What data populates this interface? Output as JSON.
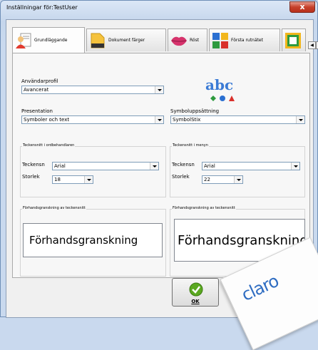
{
  "window": {
    "title": "Inställningar för:TestUser",
    "close_label": "x"
  },
  "tabs": [
    {
      "label": "Grundläggande",
      "icon": "person-icon",
      "active": true
    },
    {
      "label": "Dokument färger",
      "icon": "document-icon",
      "active": false
    },
    {
      "label": "Röst",
      "icon": "lips-icon",
      "active": false
    },
    {
      "label": "Första rutnätet",
      "icon": "grid-icon",
      "active": false
    },
    {
      "label": "",
      "icon": "frame-icon",
      "active": false
    }
  ],
  "scroll": {
    "left": "◀",
    "right": "▶"
  },
  "profile": {
    "label": "Användarprofil",
    "value": "Avancerat"
  },
  "presentation": {
    "label": "Presentation",
    "value": "Symboler och text"
  },
  "symbolset": {
    "label": "Symboluppsättning",
    "value": "SymbolStix"
  },
  "symbol_preview": {
    "text": "abc"
  },
  "editor_font": {
    "group_label": "Teckensnitt i ordbehandlaren",
    "font_label": "Teckensn",
    "font_value": "Arial",
    "size_label": "Storlek",
    "size_value": "18"
  },
  "menu_font": {
    "group_label": "Teckensnitt i menyn",
    "font_label": "Teckensn",
    "font_value": "Arial",
    "size_label": "Storlek",
    "size_value": "22"
  },
  "editor_preview": {
    "group_label": "Förhandsgranskning av teckensnitt",
    "text": "Förhandsgranskning"
  },
  "menu_preview": {
    "group_label": "Förhandsgranskning av teckensnitt",
    "text": "Förhandsgranskning"
  },
  "ok_button": {
    "label": "OK"
  },
  "logo": {
    "text": "claro"
  },
  "colors": {
    "accent_blue": "#2f6dc2",
    "ok_green": "#5aa820",
    "close_red": "#c6402a"
  }
}
